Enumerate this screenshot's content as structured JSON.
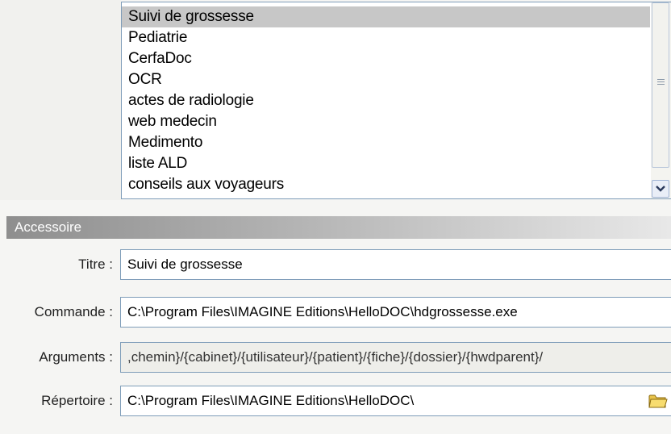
{
  "program_list": {
    "items": [
      {
        "label": "Suivi de grossesse",
        "selected": true
      },
      {
        "label": "Pediatrie",
        "selected": false
      },
      {
        "label": "CerfaDoc",
        "selected": false
      },
      {
        "label": "OCR",
        "selected": false
      },
      {
        "label": "actes de radiologie",
        "selected": false
      },
      {
        "label": "web medecin",
        "selected": false
      },
      {
        "label": "Medimento",
        "selected": false
      },
      {
        "label": "liste ALD",
        "selected": false
      },
      {
        "label": "conseils aux voyageurs",
        "selected": false
      }
    ]
  },
  "accessoire": {
    "section_title": "Accessoire",
    "titre": {
      "label": "Titre :",
      "value": "Suivi de grossesse"
    },
    "commande": {
      "label": "Commande :",
      "value": "C:\\Program Files\\IMAGINE Editions\\HelloDOC\\hdgrossesse.exe"
    },
    "arguments": {
      "label": "Arguments :",
      "value": ",chemin}/{cabinet}/{utilisateur}/{patient}/{fiche}/{dossier}/{hwdparent}/"
    },
    "repertoire": {
      "label": "Répertoire :",
      "value": "C:\\Program Files\\IMAGINE Editions\\HelloDOC\\"
    }
  },
  "icons": {
    "scroll_down": "chevron-down-icon",
    "browse_folder": "folder-icon"
  },
  "colors": {
    "selection": "#c7c7c7",
    "input_border": "#7f9db9",
    "header_dark": "#8e8e8e",
    "header_light": "#e8e8e8"
  }
}
